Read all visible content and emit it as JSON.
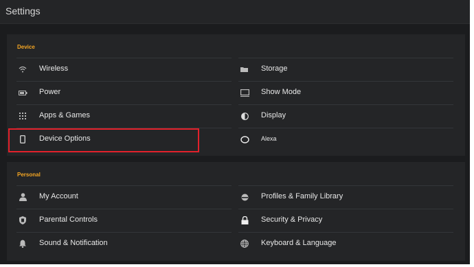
{
  "window": {
    "title": "Settings"
  },
  "device": {
    "title": "Device",
    "left": [
      {
        "icon": "wifi-icon",
        "label": "Wireless"
      },
      {
        "icon": "battery-icon",
        "label": "Power"
      },
      {
        "icon": "apps-grid-icon",
        "label": "Apps & Games"
      },
      {
        "icon": "tablet-icon",
        "label": "Device Options"
      }
    ],
    "right": [
      {
        "icon": "folder-icon",
        "label": "Storage"
      },
      {
        "icon": "monitor-icon",
        "label": "Show Mode"
      },
      {
        "icon": "contrast-icon",
        "label": "Display"
      },
      {
        "icon": "alexa-ring-icon",
        "label": "Alexa"
      }
    ]
  },
  "personal": {
    "title": "Personal",
    "left": [
      {
        "icon": "person-icon",
        "label": "My Account"
      },
      {
        "icon": "shield-icon",
        "label": "Parental Controls"
      },
      {
        "icon": "bell-icon",
        "label": "Sound & Notification"
      }
    ],
    "right": [
      {
        "icon": "profiles-icon",
        "label": "Profiles & Family Library"
      },
      {
        "icon": "lock-icon",
        "label": "Security & Privacy"
      },
      {
        "icon": "globe-icon",
        "label": "Keyboard & Language"
      }
    ]
  },
  "colors": {
    "accent": "#f5a623",
    "highlight": "#e3212b",
    "background": "#1b1c1e",
    "panel": "#242527"
  }
}
